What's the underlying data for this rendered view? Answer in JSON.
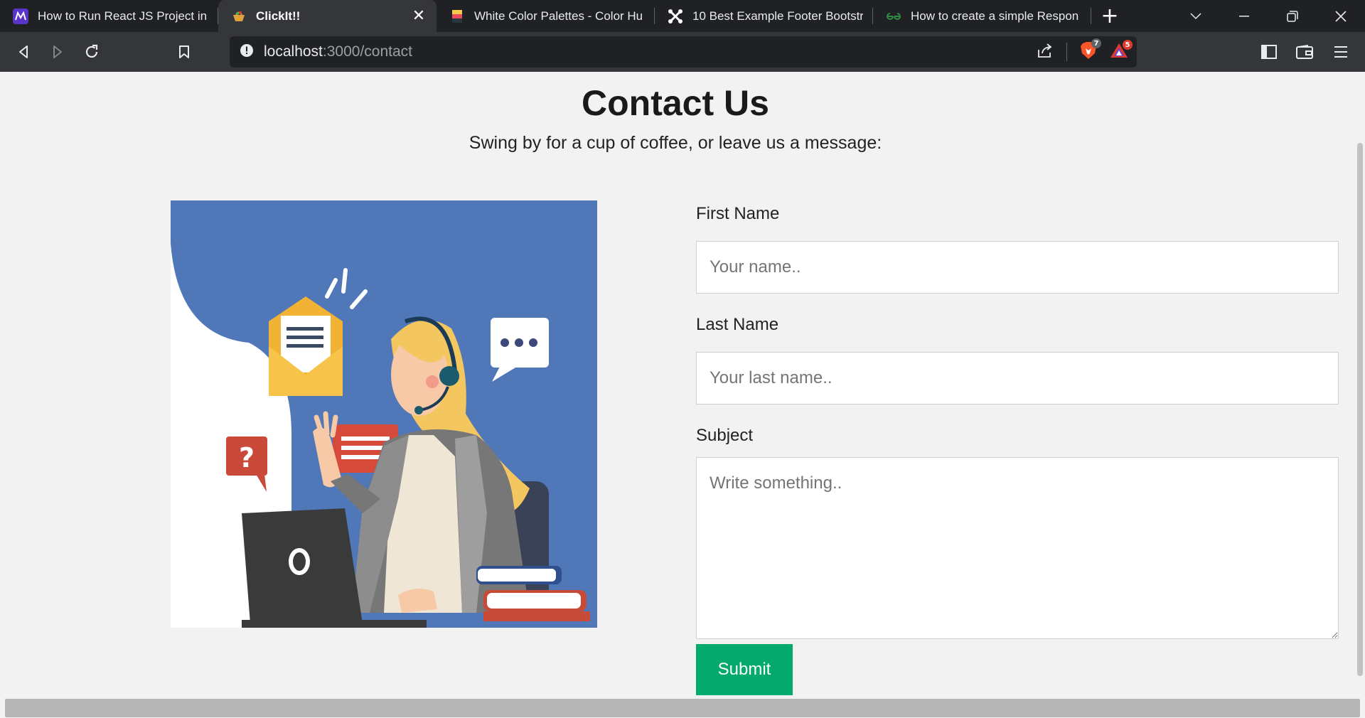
{
  "browser": {
    "tabs": [
      {
        "title": "How to Run React JS Project in",
        "icon": "react-project-site-icon",
        "active": false
      },
      {
        "title": "ClickIt!!",
        "icon": "clickit-basket-icon",
        "active": true
      },
      {
        "title": "White Color Palettes - Color Hu",
        "icon": "color-hunt-icon",
        "active": false
      },
      {
        "title": "10 Best Example Footer Bootstr",
        "icon": "joomla-style-icon",
        "active": false
      },
      {
        "title": "How to create a simple Respon",
        "icon": "geeksforgeeks-icon",
        "active": false
      }
    ],
    "url": {
      "host": "localhost",
      "path": ":3000/contact"
    },
    "brave_badge": "7",
    "rewards_badge": "5",
    "colors": {
      "tab_bar": "#202124",
      "toolbar": "#35363a",
      "brave_orange": "#fb542b",
      "rewards_red": "#e0392b"
    }
  },
  "page": {
    "title": "Contact Us",
    "subtitle": "Swing by for a cup of coffee, or leave us a message:",
    "form": {
      "first_name_label": "First Name",
      "first_name_placeholder": "Your name..",
      "last_name_label": "Last Name",
      "last_name_placeholder": "Your last name..",
      "subject_label": "Subject",
      "subject_placeholder": "Write something..",
      "submit_label": "Submit"
    },
    "colors": {
      "background": "#f2f2f2",
      "submit": "#04aa6d",
      "illustration_blue": "#5078b9"
    }
  }
}
